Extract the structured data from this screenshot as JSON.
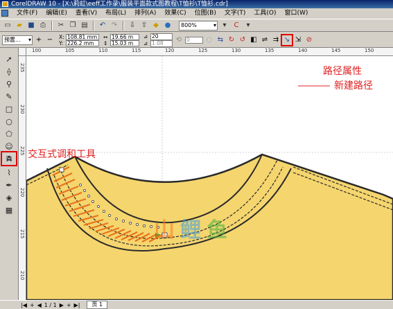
{
  "window": {
    "title": "CorelDRAW 10 - [X:\\莉虹\\eeff工作录\\服装平面款式图教程\\T恤衫\\T恤衫.cdr]"
  },
  "menu": {
    "items": [
      "文件(F)",
      "编辑(E)",
      "查看(V)",
      "布局(L)",
      "排列(A)",
      "效果(C)",
      "位图(B)",
      "文字(T)",
      "工具(O)",
      "窗口(W)"
    ]
  },
  "toolbar": {
    "zoom_value": "800%"
  },
  "property_bar": {
    "preset_value": "预置...",
    "add_label": "+",
    "remove_label": "−",
    "x_label": "X:",
    "x_value": "108.81 mm",
    "y_label": "Y:",
    "y_value": "226.2 mm",
    "w_value": "19.66 m",
    "h_value": "15.03 m",
    "steps_value": "20",
    "spacing_value": "1.08",
    "rotation_value": "0"
  },
  "rulers": {
    "top_labels": [
      "100",
      "105",
      "110",
      "115",
      "120",
      "125",
      "130",
      "135",
      "140",
      "145",
      "150"
    ],
    "left_labels": [
      "235",
      "230",
      "225",
      "220",
      "215",
      "210"
    ],
    "units": "毫米"
  },
  "annotations": {
    "path_properties": "路径属性",
    "new_path": "新建路径",
    "interactive_blend_tool": "交互式调和工具"
  },
  "watermark": {
    "text_a": "山",
    "text_b": "鲤",
    "text_c": "鱼"
  },
  "status": {
    "page_count": "1 / 1",
    "page_tab": "页 1"
  },
  "colors": {
    "shirt_fill": "#f5d56e",
    "blend_orange": "#e8741c",
    "outline": "#2a2a2a",
    "annotation_red": "#e02020",
    "highlight_red": "#e00000"
  }
}
